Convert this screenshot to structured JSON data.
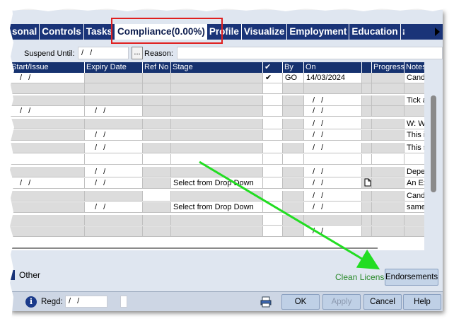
{
  "tabs": [
    {
      "label": "sonal",
      "active": false
    },
    {
      "label": "Controls",
      "active": false
    },
    {
      "label": "Tasks",
      "active": false
    },
    {
      "label": "Compliance(0.00%)",
      "active": true
    },
    {
      "label": "Profile",
      "active": false
    },
    {
      "label": "Visualize",
      "active": false
    },
    {
      "label": "Employment",
      "active": false
    },
    {
      "label": "Education",
      "active": false
    }
  ],
  "tab_more": "⁝",
  "suspend": {
    "label": "Suspend Until:",
    "value": "/  /",
    "dots": "...",
    "reason_label": "Reason:",
    "reason_value": ""
  },
  "grid": {
    "headers": [
      "Start/Issue",
      "Expiry Date",
      "Ref No",
      "Stage",
      "✔",
      "By",
      "On",
      "",
      "Progress",
      "Notes"
    ],
    "rows": [
      {
        "start": "/  /",
        "expiry": "",
        "ref": "",
        "stage": "",
        "check": "✔",
        "by": "GO",
        "on": "14/03/2024",
        "doc": "",
        "progress": "",
        "notes": "Candid"
      },
      {
        "start": "",
        "expiry": "",
        "ref": "",
        "stage": "",
        "check": "",
        "by": "",
        "on": "",
        "doc": "",
        "progress": "",
        "notes": ""
      },
      {
        "start": "",
        "expiry": "",
        "ref": "",
        "stage": "",
        "check": "",
        "by": "",
        "on": "/  /",
        "doc": "",
        "progress": "",
        "notes": "Tick ar"
      },
      {
        "start": "/  /",
        "expiry": "/  /",
        "ref": "",
        "stage": "",
        "check": "",
        "by": "",
        "on": "/  /",
        "doc": "",
        "progress": "",
        "notes": ""
      },
      {
        "start": "",
        "expiry": "",
        "ref": "",
        "stage": "",
        "check": "",
        "by": "",
        "on": "/  /",
        "doc": "",
        "progress": "",
        "notes": "W: Wa"
      },
      {
        "start": "",
        "expiry": "/  /",
        "ref": "",
        "stage": "",
        "check": "",
        "by": "",
        "on": "/  /",
        "doc": "",
        "progress": "",
        "notes": "This ite"
      },
      {
        "start": "",
        "expiry": "/  /",
        "ref": "",
        "stage": "",
        "check": "",
        "by": "",
        "on": "/  /",
        "doc": "",
        "progress": "",
        "notes": "This sh"
      },
      {
        "start": "",
        "expiry": "",
        "ref": "",
        "stage": "",
        "check": "",
        "by": "",
        "on": "",
        "doc": "",
        "progress": "",
        "notes": ""
      },
      {
        "start": "",
        "expiry": "/  /",
        "ref": "",
        "stage": "",
        "check": "",
        "by": "",
        "on": "/  /",
        "doc": "",
        "progress": "",
        "notes": "Depen"
      },
      {
        "start": "/  /",
        "expiry": "/  /",
        "ref": "",
        "stage": "Select from Drop Down",
        "check": "",
        "by": "",
        "on": "/  /",
        "doc": "doc",
        "progress": "",
        "notes": "An Exa"
      },
      {
        "start": "",
        "expiry": "",
        "ref": "",
        "stage": "",
        "check": "",
        "by": "",
        "on": "/  /",
        "doc": "",
        "progress": "",
        "notes": "Candid"
      },
      {
        "start": "",
        "expiry": "/  /",
        "ref": "",
        "stage": "Select from Drop Down",
        "check": "",
        "by": "",
        "on": "/  /",
        "doc": "",
        "progress": "",
        "notes": "same a"
      },
      {
        "start": "",
        "expiry": "",
        "ref": "",
        "stage": "",
        "check": "",
        "by": "",
        "on": "",
        "doc": "",
        "progress": "",
        "notes": ""
      },
      {
        "start": "",
        "expiry": "",
        "ref": "",
        "stage": "",
        "check": "",
        "by": "",
        "on": "/  /",
        "doc": "",
        "progress": "",
        "notes": ""
      }
    ]
  },
  "bottom": {
    "other_label": "Other",
    "clean_license": "Clean License",
    "endorsements": "Endorsements",
    "regd_label": "Regd:",
    "regd_value": "/  /",
    "buttons": {
      "ok": "OK",
      "apply": "Apply",
      "cancel": "Cancel",
      "help": "Help"
    }
  },
  "colors": {
    "tab_bg": "#1a3478",
    "highlight": "#e02020",
    "arrow": "#22dd22",
    "clean_license": "#2a8a2a"
  },
  "icons": {
    "info": "info-icon",
    "print": "print-icon",
    "document": "document-icon",
    "tab-scroll": "triangle-right-icon"
  }
}
